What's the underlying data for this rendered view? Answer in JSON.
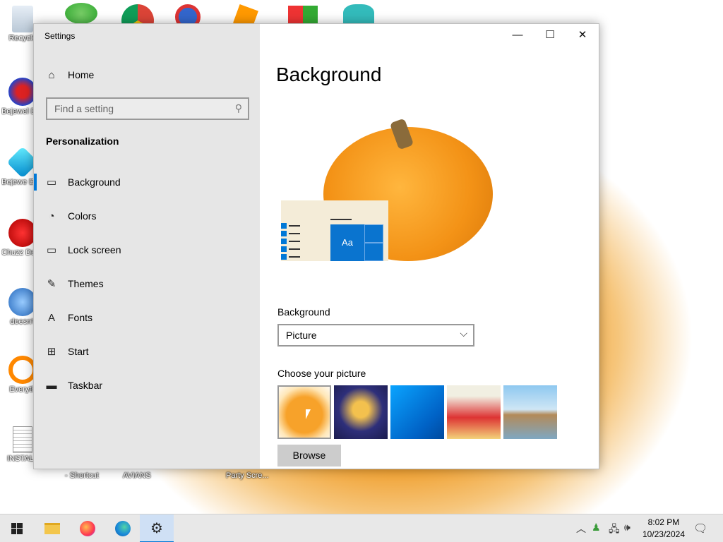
{
  "desktop": {
    "icons": [
      {
        "label": "Recycle",
        "icon": "recycle-bin-icon"
      },
      {
        "label": "Bejewel Delux",
        "icon": "bejeweled-2-icon"
      },
      {
        "label": "Bejewe Delux",
        "icon": "bejeweled-icon"
      },
      {
        "label": "Chuzz Delux",
        "icon": "chuzzle-icon"
      },
      {
        "label": "doesn't",
        "icon": "thunderbird-icon"
      },
      {
        "label": "Everyth",
        "icon": "everything-search-icon"
      },
      {
        "label": "INSTALL",
        "icon": "document-icon"
      }
    ],
    "bottom_labels": [
      "- Shortcut",
      "AVIANS",
      "Party Scre..."
    ],
    "top_icons": [
      "people-icon",
      "chrome-icon",
      "app-p-icon",
      "app-orange-icon",
      "windows-logo-icon",
      "avatar-icon"
    ],
    "wallpaper_color": "#f0a030"
  },
  "window": {
    "title": "Settings",
    "buttons": {
      "minimize": "—",
      "maximize": "☐",
      "close": "✕"
    }
  },
  "sidebar": {
    "home": "Home",
    "search_placeholder": "Find a setting",
    "section_title": "Personalization",
    "items": [
      {
        "label": "Background",
        "icon": "image-icon",
        "active": true
      },
      {
        "label": "Colors",
        "icon": "palette-icon",
        "active": false
      },
      {
        "label": "Lock screen",
        "icon": "lock-screen-icon",
        "active": false
      },
      {
        "label": "Themes",
        "icon": "themes-icon",
        "active": false
      },
      {
        "label": "Fonts",
        "icon": "fonts-icon",
        "active": false
      },
      {
        "label": "Start",
        "icon": "start-icon",
        "active": false
      },
      {
        "label": "Taskbar",
        "icon": "taskbar-icon",
        "active": false
      }
    ]
  },
  "main": {
    "title": "Background",
    "preview_tile_text": "Aa",
    "background_label": "Background",
    "background_value": "Picture",
    "choose_label": "Choose your picture",
    "browse_label": "Browse",
    "thumbnails": [
      {
        "name": "pumpkin",
        "selected": true
      },
      {
        "name": "cartoon-face",
        "selected": false
      },
      {
        "name": "windows-blue",
        "selected": false
      },
      {
        "name": "cartoon-character",
        "selected": false
      },
      {
        "name": "beach-rocks",
        "selected": false
      }
    ],
    "accent_color": "#0078d7"
  },
  "taskbar": {
    "items": [
      "start-button-icon",
      "file-explorer-icon",
      "firefox-icon",
      "edge-icon",
      "settings-gear-icon"
    ],
    "time": "8:02 PM",
    "date": "10/23/2024"
  }
}
